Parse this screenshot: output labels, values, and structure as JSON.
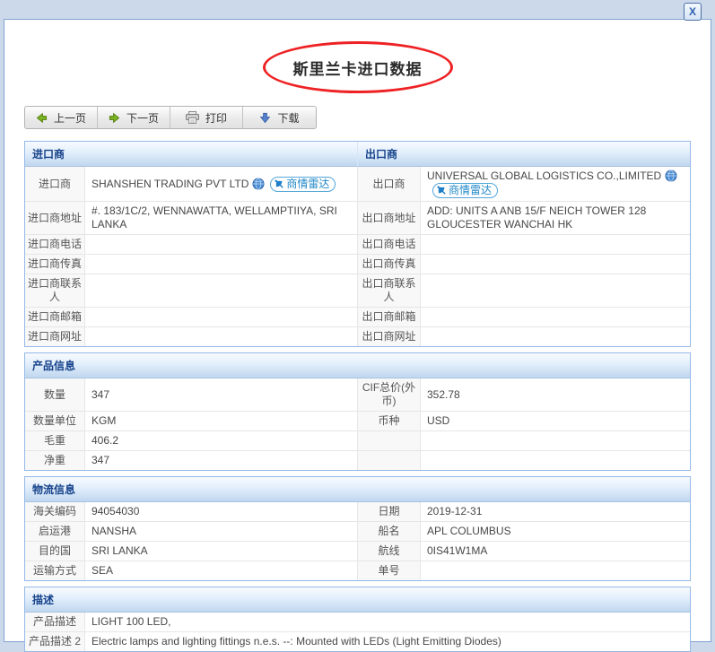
{
  "chrome": {
    "close_label": "X"
  },
  "page": {
    "title": "斯里兰卡进口数据"
  },
  "toolbar": {
    "prev": "上一页",
    "next": "下一页",
    "print": "打印",
    "download": "下载"
  },
  "badge": {
    "label": "商情雷达"
  },
  "colors": {
    "page_band": "#ccd9ea",
    "panel_border": "#7ea1d1",
    "section_header_text": "#15428b",
    "table_border": "#95b8e7",
    "annotation_red": "#ee2224",
    "badge_blue": "#2287c8"
  },
  "sections": {
    "company": {
      "left_header": "进口商",
      "right_header": "出口商",
      "rows": [
        {
          "l_label": "进口商",
          "l_value": "SHANSHEN TRADING PVT LTD",
          "r_label": "出口商",
          "r_value": "UNIVERSAL GLOBAL LOGISTICS CO.,LIMITED"
        },
        {
          "l_label": "进口商地址",
          "l_value": "#. 183/1C/2, WENNAWATTA, WELLAMPTIIYA, SRI LANKA",
          "r_label": "出口商地址",
          "r_value": "ADD: UNITS A ANB 15/F NEICH TOWER 128 GLOUCESTER WANCHAI HK"
        },
        {
          "l_label": "进口商电话",
          "l_value": "",
          "r_label": "出口商电话",
          "r_value": ""
        },
        {
          "l_label": "进口商传真",
          "l_value": "",
          "r_label": "出口商传真",
          "r_value": ""
        },
        {
          "l_label": "进口商联系人",
          "l_value": "",
          "r_label": "出口商联系人",
          "r_value": ""
        },
        {
          "l_label": "进口商邮箱",
          "l_value": "",
          "r_label": "出口商邮箱",
          "r_value": ""
        },
        {
          "l_label": "进口商网址",
          "l_value": "",
          "r_label": "出口商网址",
          "r_value": ""
        }
      ]
    },
    "product": {
      "header": "产品信息",
      "rows": [
        {
          "l_label": "数量",
          "l_value": "347",
          "r_label": "CIF总价(外币)",
          "r_value": "352.78"
        },
        {
          "l_label": "数量单位",
          "l_value": "KGM",
          "r_label": "币种",
          "r_value": "USD"
        },
        {
          "l_label": "毛重",
          "l_value": "406.2",
          "r_label": "",
          "r_value": ""
        },
        {
          "l_label": "净重",
          "l_value": "347",
          "r_label": "",
          "r_value": ""
        }
      ]
    },
    "logistics": {
      "header": "物流信息",
      "rows": [
        {
          "l_label": "海关编码",
          "l_value": "94054030",
          "r_label": "日期",
          "r_value": "2019-12-31"
        },
        {
          "l_label": "启运港",
          "l_value": "NANSHA",
          "r_label": "船名",
          "r_value": "APL COLUMBUS"
        },
        {
          "l_label": "目的国",
          "l_value": "SRI LANKA",
          "r_label": "航线",
          "r_value": "0IS41W1MA"
        },
        {
          "l_label": "运输方式",
          "l_value": "SEA",
          "r_label": "单号",
          "r_value": ""
        }
      ]
    },
    "description": {
      "header": "描述",
      "rows": [
        {
          "label": "产品描述",
          "value": "LIGHT 100 LED,"
        },
        {
          "label": "产品描述 2",
          "value": "Electric lamps and lighting fittings n.e.s. --: Mounted with LEDs (Light Emitting Diodes)"
        }
      ]
    }
  }
}
